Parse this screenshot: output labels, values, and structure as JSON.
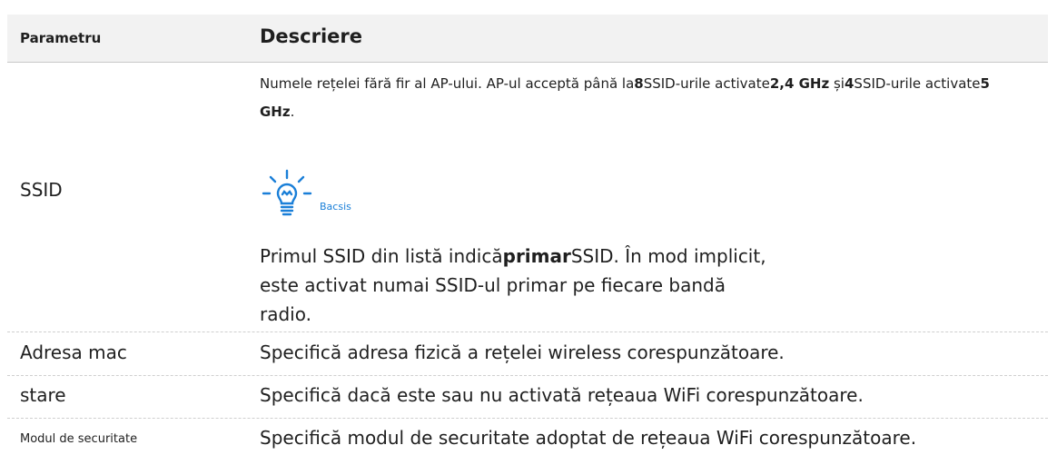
{
  "header": {
    "col1": "Parametru",
    "col2": "Descriere"
  },
  "rows": [
    {
      "param": "SSID",
      "desc_parts": [
        "Numele rețelei fără fir al AP-ului. AP-ul acceptă până la",
        "8",
        "SSID-urile activate",
        "2,4 GHz",
        " și",
        "4",
        "SSID-urile activate",
        "5 GHz",
        "."
      ],
      "tip_label": "Bacsis",
      "note_parts": [
        "Primul SSID din listă indică",
        "primar",
        "SSID. În mod implicit, este activat numai SSID-ul primar pe fiecare bandă radio."
      ]
    },
    {
      "param": "Adresa mac",
      "desc": "Specifică adresa fizică a rețelei wireless corespunzătoare."
    },
    {
      "param": "stare",
      "desc": "Specifică dacă este sau nu activată rețeaua WiFi corespunzătoare."
    },
    {
      "param": "Modul de securitate",
      "desc": "Specifică modul de securitate adoptat de rețeaua WiFi corespunzătoare."
    }
  ],
  "colors": {
    "accent": "#1a7fd8",
    "header_bg": "#f2f2f2"
  },
  "icons": {
    "tip": "lightbulb-icon"
  }
}
